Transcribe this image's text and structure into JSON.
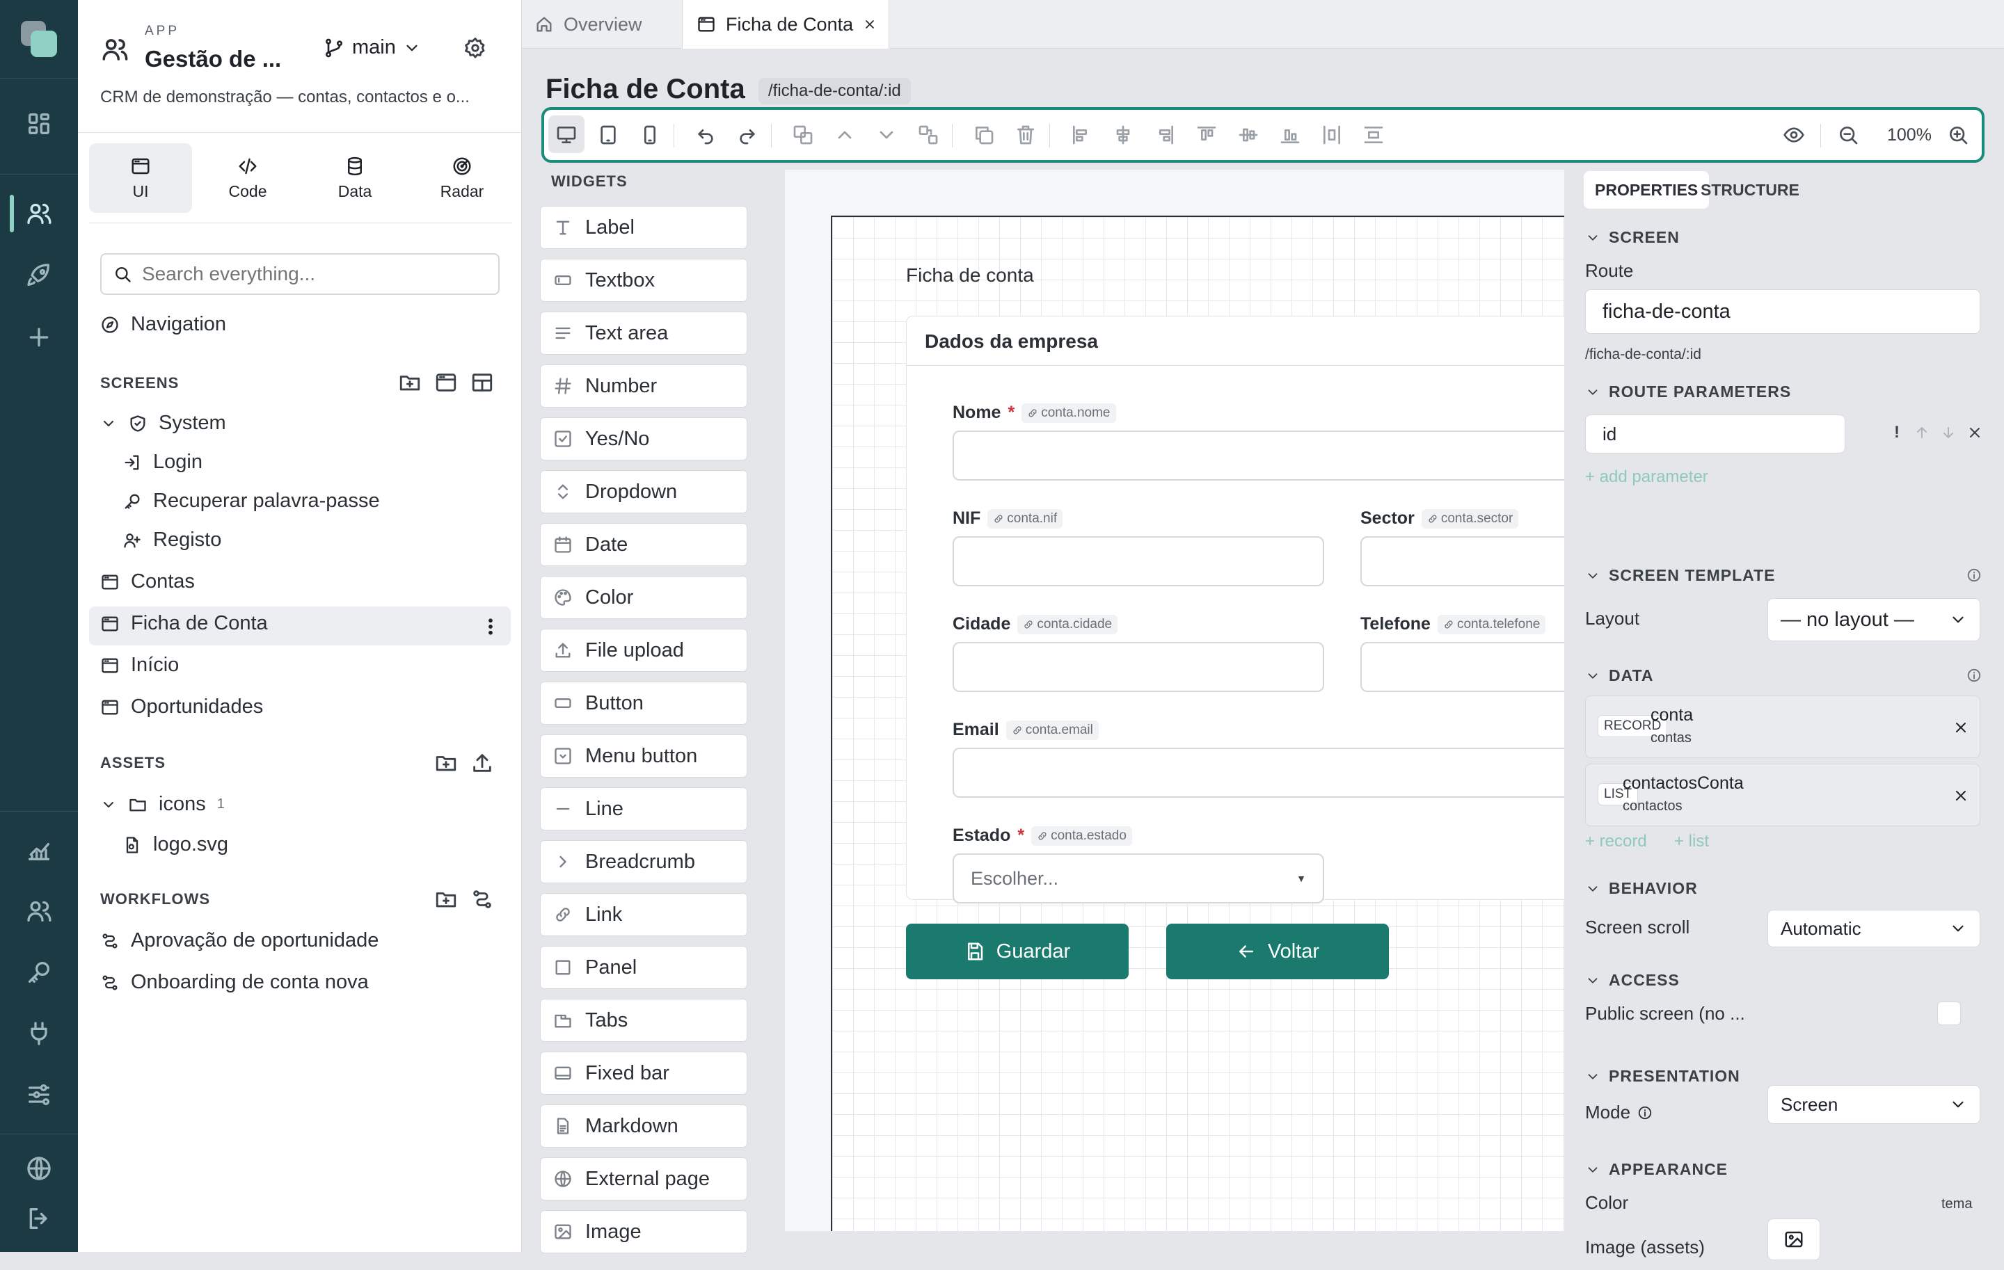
{
  "app": {
    "kicker": "APP",
    "name": "Gestão de ...",
    "branch": "main",
    "description": "CRM de demonstração — contas, contactos e o..."
  },
  "modes": [
    {
      "label": "UI"
    },
    {
      "label": "Code"
    },
    {
      "label": "Data"
    },
    {
      "label": "Radar"
    }
  ],
  "search": {
    "placeholder": "Search everything..."
  },
  "navigation_label": "Navigation",
  "screens": {
    "title": "SCREENS",
    "group": "System",
    "group_items": [
      "Login",
      "Recuperar palavra-passe",
      "Registo"
    ],
    "items": [
      "Contas",
      "Ficha de Conta",
      "Início",
      "Oportunidades"
    ],
    "selected": "Ficha de Conta"
  },
  "assets": {
    "title": "ASSETS",
    "folder": "icons",
    "folder_count": "1",
    "file": "logo.svg"
  },
  "workflows": {
    "title": "WORKFLOWS",
    "items": [
      "Aprovação de oportunidade",
      "Onboarding de conta nova"
    ]
  },
  "tabs": [
    {
      "label": "Overview"
    },
    {
      "label": "Ficha de Conta",
      "active": true
    }
  ],
  "page": {
    "title": "Ficha de Conta",
    "route": "/ficha-de-conta/:id"
  },
  "toolbar": {
    "zoom": "100%"
  },
  "widgets": {
    "title": "WIDGETS",
    "items": [
      "Label",
      "Textbox",
      "Text area",
      "Number",
      "Yes/No",
      "Dropdown",
      "Date",
      "Color",
      "File upload",
      "Button",
      "Menu button",
      "Line",
      "Breadcrumb",
      "Link",
      "Panel",
      "Tabs",
      "Fixed bar",
      "Markdown",
      "External page",
      "Image"
    ]
  },
  "form": {
    "heading": "Ficha de conta",
    "panel_title": "Dados da empresa",
    "fields": {
      "nome": {
        "label": "Nome",
        "bind": "conta.nome",
        "required": true
      },
      "nif": {
        "label": "NIF",
        "bind": "conta.nif"
      },
      "sector": {
        "label": "Sector",
        "bind": "conta.sector"
      },
      "cidade": {
        "label": "Cidade",
        "bind": "conta.cidade"
      },
      "telefone": {
        "label": "Telefone",
        "bind": "conta.telefone"
      },
      "email": {
        "label": "Email",
        "bind": "conta.email"
      },
      "estado": {
        "label": "Estado",
        "bind": "conta.estado",
        "required": true,
        "placeholder": "Escolher..."
      }
    },
    "save": "Guardar",
    "back": "Voltar"
  },
  "props": {
    "tabs": [
      "PROPERTIES",
      "STRUCTURE"
    ],
    "screen": {
      "title": "SCREEN",
      "route_label": "Route",
      "route_value": "ficha-de-conta",
      "route_path": "/ficha-de-conta/:id"
    },
    "params": {
      "title": "ROUTE PARAMETERS",
      "param": "id",
      "add": "+ add parameter",
      "required_mark": "!"
    },
    "template": {
      "title": "SCREEN TEMPLATE",
      "layout_label": "Layout",
      "layout_value": "— no layout —"
    },
    "data": {
      "title": "DATA",
      "sources": [
        {
          "kind": "RECORD",
          "name": "conta",
          "entity": "contas"
        },
        {
          "kind": "LIST",
          "name": "contactosConta",
          "entity": "contactos"
        }
      ],
      "add_record": "+ record",
      "add_list": "+ list"
    },
    "behavior": {
      "title": "BEHAVIOR",
      "scroll_label": "Screen scroll",
      "scroll_value": "Automatic"
    },
    "access": {
      "title": "ACCESS",
      "public_label": "Public screen (no ..."
    },
    "presentation": {
      "title": "PRESENTATION",
      "mode_label": "Mode",
      "mode_value": "Screen"
    },
    "appearance": {
      "title": "APPEARANCE",
      "color_label": "Color",
      "color_value": "tema",
      "image_label": "Image (assets)"
    }
  },
  "colors": {
    "rail": "#1c3a44",
    "accent": "#1a7a6e",
    "selection": "#1a8a7a"
  }
}
